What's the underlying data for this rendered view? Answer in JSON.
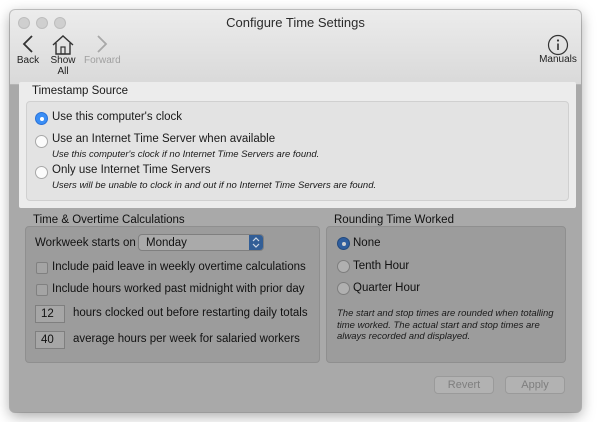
{
  "window": {
    "title": "Configure Time Settings"
  },
  "toolbar": {
    "back_label": "Back",
    "show_all_label": "Show All",
    "forward_label": "Forward",
    "manuals_label": "Manuals"
  },
  "timestamp_source": {
    "heading": "Timestamp Source",
    "options": [
      {
        "label": "Use this computer's clock",
        "note": "",
        "selected": true
      },
      {
        "label": "Use an Internet Time Server when available",
        "note": "Use this computer's clock if no Internet Time Servers are found.",
        "selected": false
      },
      {
        "label": "Only use Internet Time Servers",
        "note": "Users will be unable to clock in and out if no Internet Time Servers are found.",
        "selected": false
      }
    ]
  },
  "overtime": {
    "heading": "Time & Overtime Calculations",
    "workweek_label": "Workweek starts on",
    "workweek_value": "Monday",
    "paid_leave_label": "Include paid leave in weekly overtime calculations",
    "paid_leave_checked": false,
    "midnight_label": "Include hours worked past midnight with prior day",
    "midnight_checked": false,
    "hours_clocked_out_value": "12",
    "hours_clocked_out_label": "hours clocked out before restarting daily totals",
    "salaried_hours_value": "40",
    "salaried_hours_label": "average hours per week for salaried workers"
  },
  "rounding": {
    "heading": "Rounding Time Worked",
    "options": [
      {
        "label": "None",
        "selected": true
      },
      {
        "label": "Tenth Hour",
        "selected": false
      },
      {
        "label": "Quarter Hour",
        "selected": false
      }
    ],
    "note": "The start and stop times are rounded when totalling time worked. The actual start and stop times are always recorded and displayed."
  },
  "footer": {
    "revert_label": "Revert",
    "apply_label": "Apply"
  },
  "colors": {
    "accent": "#3a8ef5",
    "dimmed_background": "#a9a9a9"
  }
}
